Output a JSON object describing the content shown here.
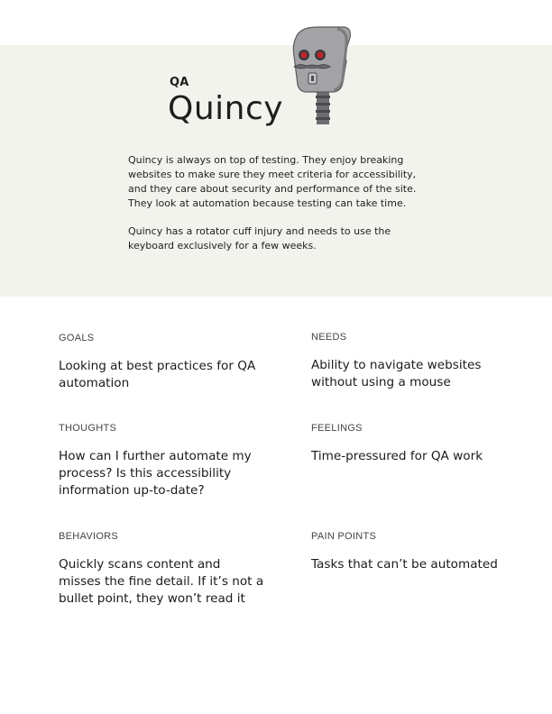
{
  "persona": {
    "role": "QA",
    "name": "Quincy",
    "bio": [
      "Quincy is always on top of testing. They enjoy breaking websites to make sure they meet criteria for accessibility, and they care about security and performance of the site. They look at automation because testing can take time.",
      "Quincy has a rotator cuff injury and needs to use the keyboard exclusively for a few weeks."
    ]
  },
  "sections": {
    "goals": {
      "label": "GOALS",
      "text": "Looking at best practices for QA automation"
    },
    "needs": {
      "label": "NEEDS",
      "text": "Ability to navigate websites without using a mouse"
    },
    "thoughts": {
      "label": "THOUGHTS",
      "text": "How can I further automate my process? Is this accessibility information up-to-date?"
    },
    "feelings": {
      "label": "FEELINGS",
      "text": "Time-pressured for QA work"
    },
    "behaviors": {
      "label": "BEHAVIORS",
      "text": "Quickly scans content and misses the fine detail. If it’s not a bullet point, they won’t read it"
    },
    "pain_points": {
      "label": "PAIN POINTS",
      "text": "Tasks that can’t be automated"
    }
  },
  "colors": {
    "hero_background": "#f3f3ee",
    "robot_body": "#9a9a9c",
    "robot_eyes": "#c0262d"
  },
  "icons": {
    "avatar": "robot-avatar-icon"
  }
}
